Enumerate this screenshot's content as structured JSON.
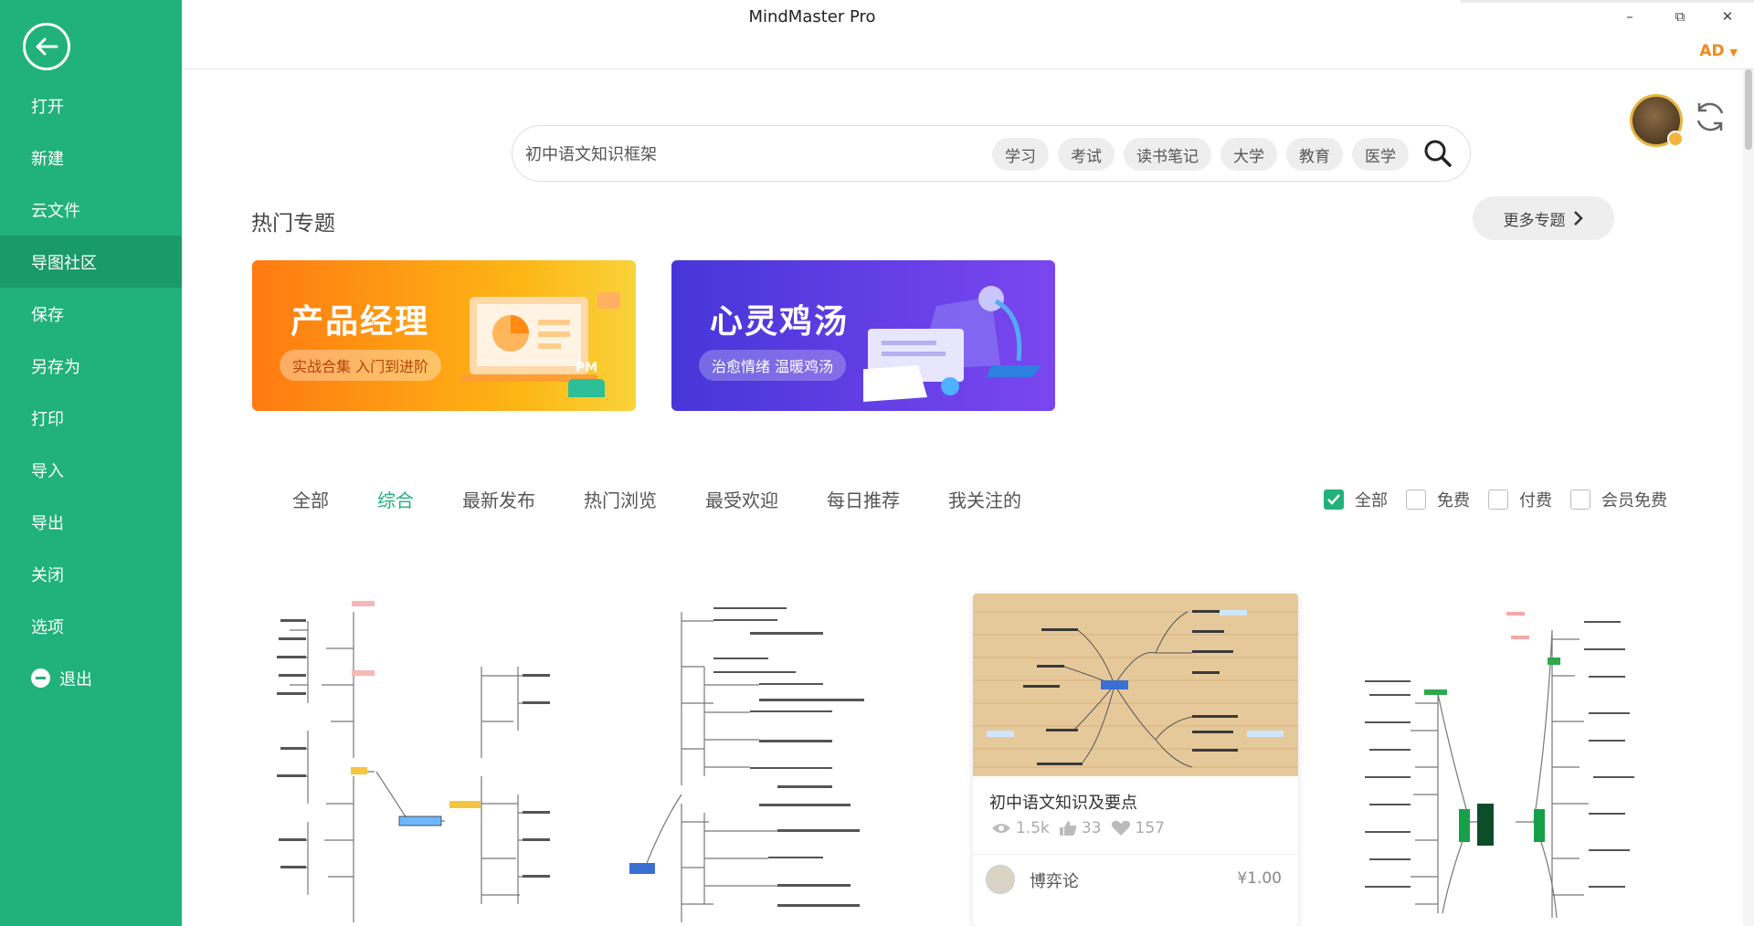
{
  "window": {
    "title": "MindMaster Pro",
    "account": "AD",
    "controls": {
      "minimize": "–",
      "restore": "⧉",
      "close": "✕"
    }
  },
  "sidebar": {
    "back_icon": "back-arrow-icon",
    "items": [
      {
        "label": "打开"
      },
      {
        "label": "新建"
      },
      {
        "label": "云文件"
      },
      {
        "label": "导图社区",
        "active": true
      },
      {
        "label": "保存"
      },
      {
        "label": "另存为"
      },
      {
        "label": "打印"
      },
      {
        "label": "导入"
      },
      {
        "label": "导出"
      },
      {
        "label": "关闭"
      },
      {
        "label": "选项"
      },
      {
        "label": "退出",
        "icon": "exit-icon"
      }
    ]
  },
  "search": {
    "value": "初中语文知识框架",
    "tags": [
      "学习",
      "考试",
      "读书笔记",
      "大学",
      "教育",
      "医学"
    ]
  },
  "topics": {
    "title": "热门专题",
    "more": "更多专题",
    "banners": [
      {
        "title": "产品经理",
        "subtitle": "实战合集 入门到进阶",
        "badge": "PM",
        "color": "#ff8a14"
      },
      {
        "title": "心灵鸡汤",
        "subtitle": "治愈情绪 温暖鸡汤",
        "color": "#5a3de2"
      }
    ]
  },
  "tabs": {
    "items": [
      "全部",
      "综合",
      "最新发布",
      "热门浏览",
      "最受欢迎",
      "每日推荐",
      "我关注的"
    ],
    "active": "综合"
  },
  "filters": [
    {
      "label": "全部",
      "checked": true
    },
    {
      "label": "免费",
      "checked": false
    },
    {
      "label": "付费",
      "checked": false
    },
    {
      "label": "会员免费",
      "checked": false
    }
  ],
  "cards": [
    {
      "kind": "mindmap-preview"
    },
    {
      "kind": "mindmap-preview"
    },
    {
      "kind": "mindmap-preview",
      "title": "初中语文知识及要点",
      "views": "1.5k",
      "likes": "33",
      "favorites": "157",
      "author": "博弈论",
      "price": "¥1.00"
    },
    {
      "kind": "mindmap-preview"
    }
  ],
  "colors": {
    "accent": "#21b17a",
    "account": "#f08a1b"
  }
}
